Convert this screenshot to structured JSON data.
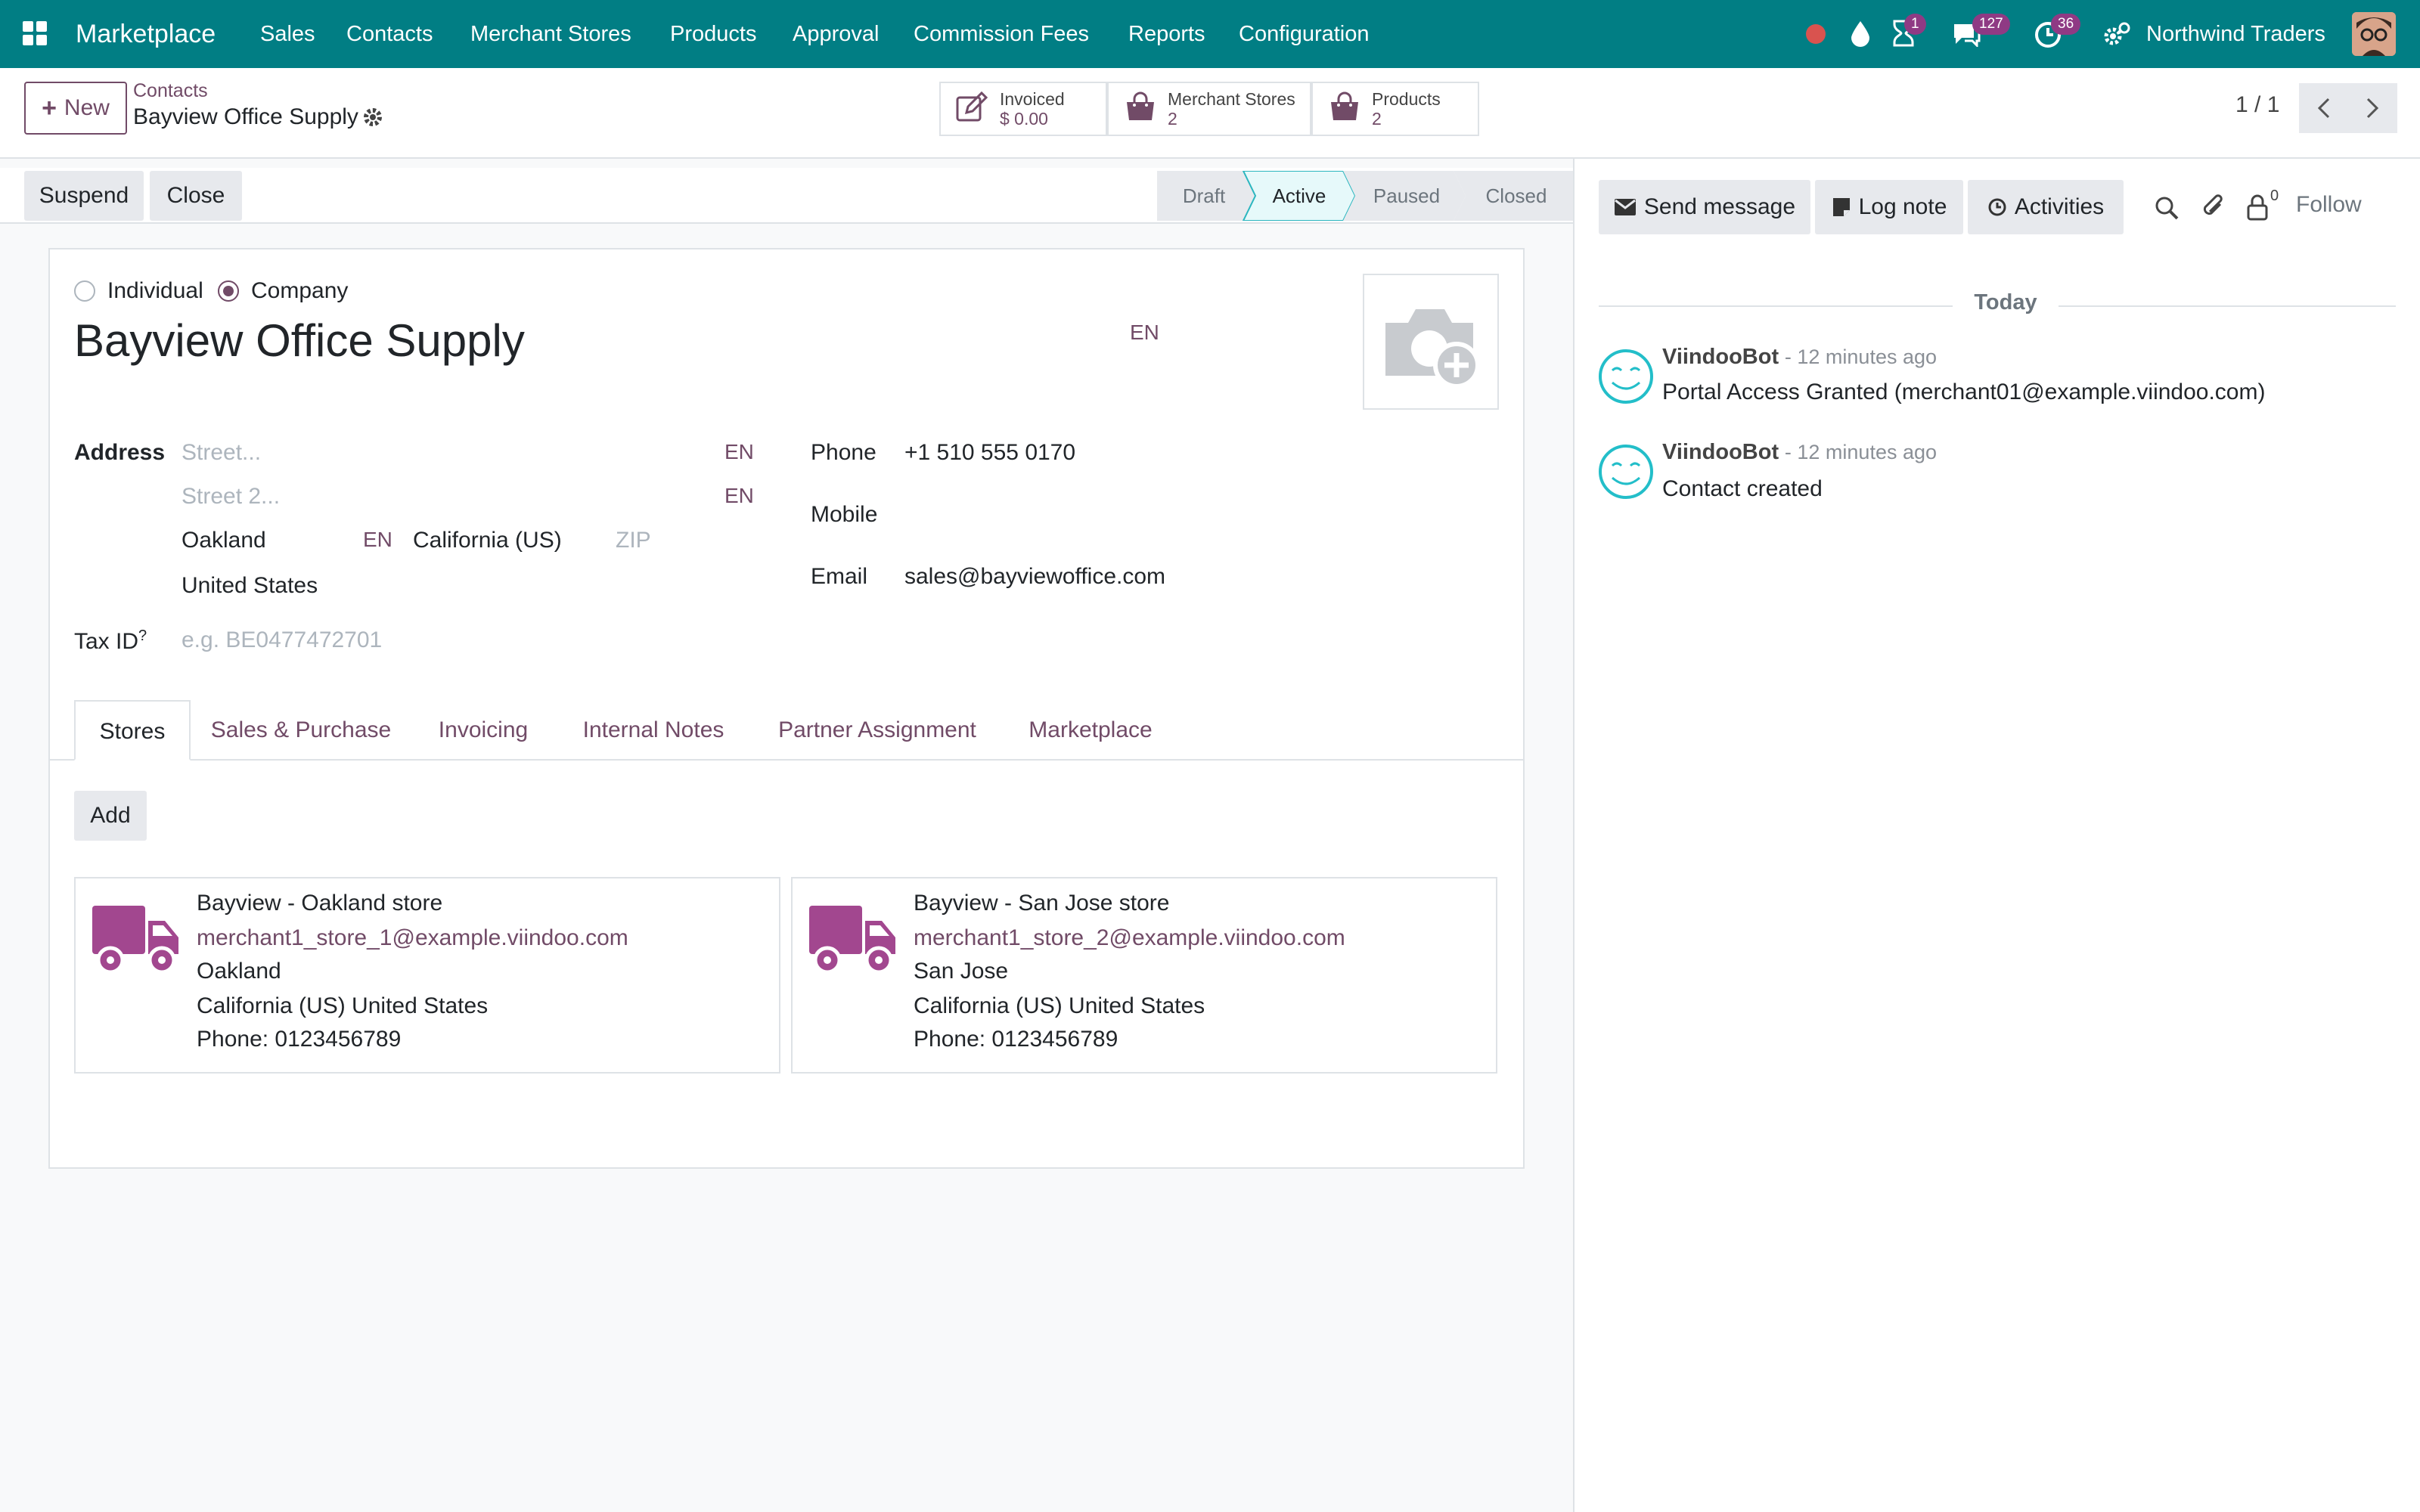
{
  "navbar": {
    "app_name": "Marketplace",
    "menu": [
      "Sales",
      "Contacts",
      "Merchant Stores",
      "Products",
      "Approval",
      "Commission Fees",
      "Reports",
      "Configuration"
    ],
    "badges": {
      "activity": "1",
      "messages": "127",
      "clock": "36"
    },
    "company": "Northwind Traders",
    "accent": "#017e84"
  },
  "control": {
    "new_label": "New",
    "breadcrumb_parent": "Contacts",
    "record_name": "Bayview Office Supply",
    "stats": [
      {
        "label": "Invoiced",
        "value": "$ 0.00"
      },
      {
        "label": "Merchant Stores",
        "value": "2"
      },
      {
        "label": "Products",
        "value": "2"
      }
    ],
    "pager": "1 / 1"
  },
  "statusbar": {
    "buttons": [
      "Suspend",
      "Close"
    ],
    "stages": [
      "Draft",
      "Active",
      "Paused",
      "Closed"
    ],
    "active_stage": "Active"
  },
  "form": {
    "type_options": [
      "Individual",
      "Company"
    ],
    "selected_type": "Company",
    "name": "Bayview Office Supply",
    "lang": "EN",
    "address_label": "Address",
    "street_placeholder": "Street...",
    "street2_placeholder": "Street 2...",
    "city": "Oakland",
    "state": "California (US)",
    "zip_placeholder": "ZIP",
    "country": "United States",
    "tax_label": "Tax ID",
    "tax_help": "?",
    "tax_placeholder": "e.g. BE0477472701",
    "phone_label": "Phone",
    "phone": "+1 510 555 0170",
    "mobile_label": "Mobile",
    "email_label": "Email",
    "email": "sales@bayviewoffice.com"
  },
  "tabs": [
    "Stores",
    "Sales & Purchase",
    "Invoicing",
    "Internal Notes",
    "Partner Assignment",
    "Marketplace"
  ],
  "active_tab": "Stores",
  "stores": {
    "add_label": "Add",
    "items": [
      {
        "name": "Bayview - Oakland store",
        "email": "merchant1_store_1@example.viindoo.com",
        "city": "Oakland",
        "region": "California (US) United States",
        "phone": "Phone: 0123456789"
      },
      {
        "name": "Bayview - San Jose store",
        "email": "merchant1_store_2@example.viindoo.com",
        "city": "San Jose",
        "region": "California (US) United States",
        "phone": "Phone: 0123456789"
      }
    ]
  },
  "chatter": {
    "send_message": "Send message",
    "log_note": "Log note",
    "activities": "Activities",
    "followers_count": "0",
    "follow": "Follow",
    "date_separator": "Today",
    "messages": [
      {
        "author": "ViindooBot",
        "date": "- 12 minutes ago",
        "body": "Portal Access Granted (merchant01@example.viindoo.com)"
      },
      {
        "author": "ViindooBot",
        "date": "- 12 minutes ago",
        "body": "Contact created"
      }
    ]
  }
}
